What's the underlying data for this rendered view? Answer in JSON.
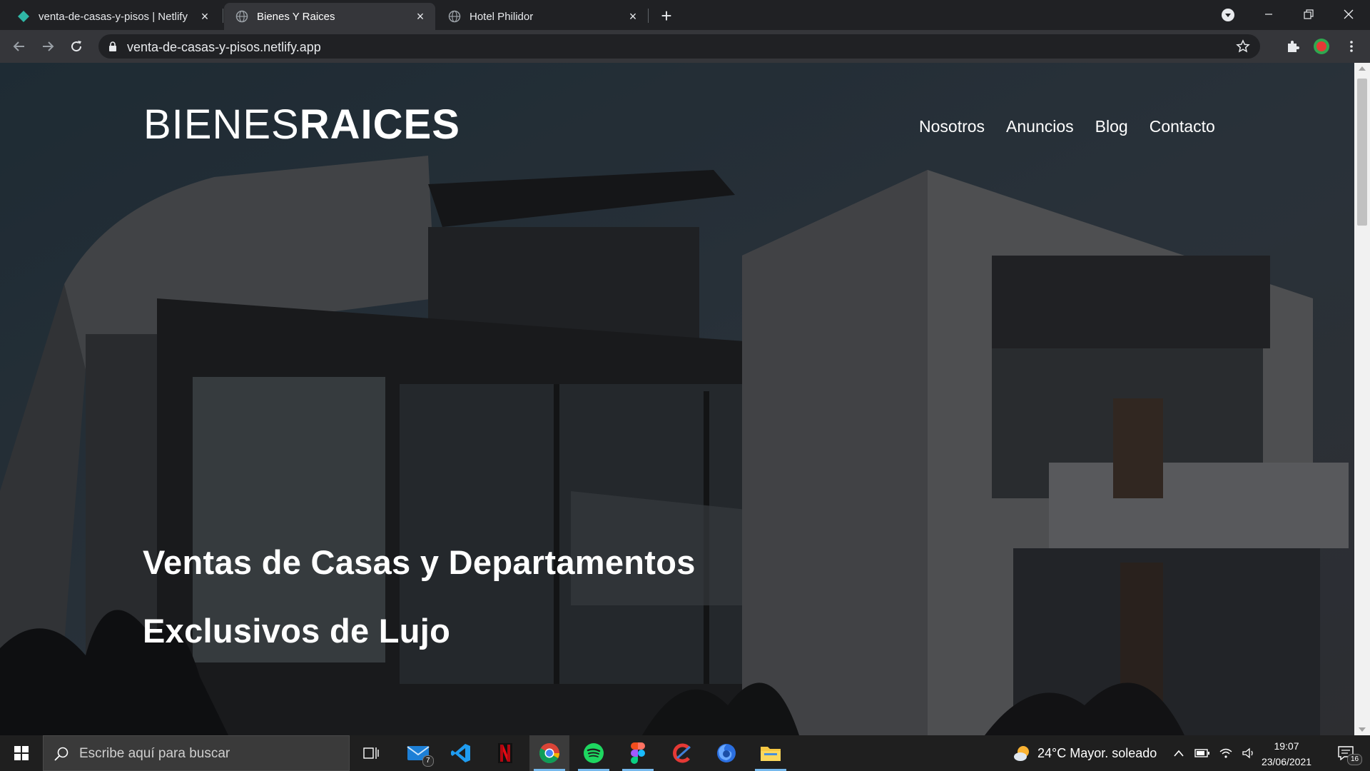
{
  "browser": {
    "tabs": [
      {
        "title": "venta-de-casas-y-pisos | Netlify",
        "active": false,
        "favicon": "netlify-diamond-icon"
      },
      {
        "title": "Bienes Y Raices",
        "active": true,
        "favicon": "globe-icon"
      },
      {
        "title": "Hotel Philidor",
        "active": false,
        "favicon": "globe-icon"
      }
    ],
    "new_tab": "+",
    "url": "venta-de-casas-y-pisos.netlify.app"
  },
  "page": {
    "logo_light": "BIENES",
    "logo_bold": "RAICES",
    "nav": [
      "Nosotros",
      "Anuncios",
      "Blog",
      "Contacto"
    ],
    "hero_line1": "Ventas de Casas y Departamentos",
    "hero_line2": "Exclusivos de Lujo"
  },
  "taskbar": {
    "search_placeholder": "Escribe aquí para buscar",
    "mail_badge": "7",
    "weather": "24°C  Mayor. soleado",
    "time": "19:07",
    "date": "23/06/2021",
    "notifications": "16"
  },
  "colors": {
    "chrome_dark": "#202124",
    "chrome_toolbar": "#35363a",
    "taskbar": "#1f1f1f",
    "netlify_accent": "#2fb7a6"
  }
}
